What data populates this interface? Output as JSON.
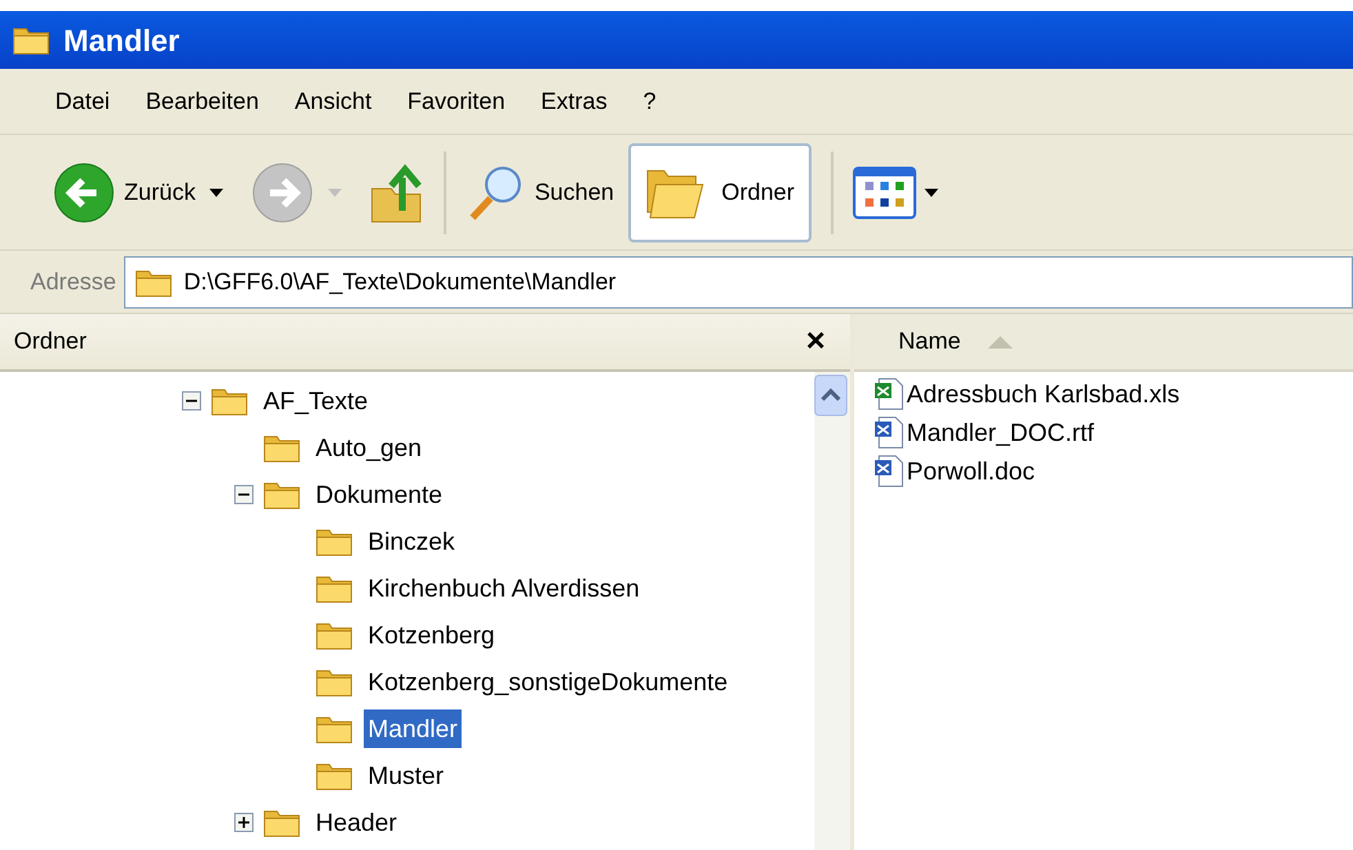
{
  "window": {
    "title": "Mandler"
  },
  "menu": [
    "Datei",
    "Bearbeiten",
    "Ansicht",
    "Favoriten",
    "Extras",
    "?"
  ],
  "toolbar": {
    "back": "Zurück",
    "search": "Suchen",
    "folders": {
      "label": "Ordner",
      "selected": true
    }
  },
  "address": {
    "label": "Adresse",
    "value": "D:\\GFF6.0\\AF_Texte\\Dokumente\\Mandler"
  },
  "folder_pane": {
    "title": "Ordner",
    "close": "×",
    "tree": [
      {
        "label": "AF_Texte",
        "has_children": true,
        "expanded": true,
        "selected": false,
        "children": [
          {
            "label": "Auto_gen",
            "has_children": false,
            "selected": false
          },
          {
            "label": "Dokumente",
            "has_children": true,
            "expanded": true,
            "selected": false,
            "children": [
              {
                "label": "Binczek",
                "has_children": false,
                "selected": false
              },
              {
                "label": "Kirchenbuch Alverdissen",
                "has_children": false,
                "selected": false
              },
              {
                "label": "Kotzenberg",
                "has_children": false,
                "selected": false
              },
              {
                "label": "Kotzenberg_sonstigeDokumente",
                "has_children": false,
                "selected": false
              },
              {
                "label": "Mandler",
                "has_children": false,
                "selected": true
              },
              {
                "label": "Muster",
                "has_children": false,
                "selected": false
              }
            ]
          },
          {
            "label": "Header",
            "has_children": true,
            "expanded": false,
            "selected": false
          }
        ]
      }
    ]
  },
  "file_list": {
    "columns": [
      "Name"
    ],
    "files": [
      {
        "name": "Adressbuch Karlsbad.xls",
        "kind": "spreadsheet"
      },
      {
        "name": "Mandler_DOC.rtf",
        "kind": "document"
      },
      {
        "name": "Porwoll.doc",
        "kind": "document"
      }
    ]
  }
}
